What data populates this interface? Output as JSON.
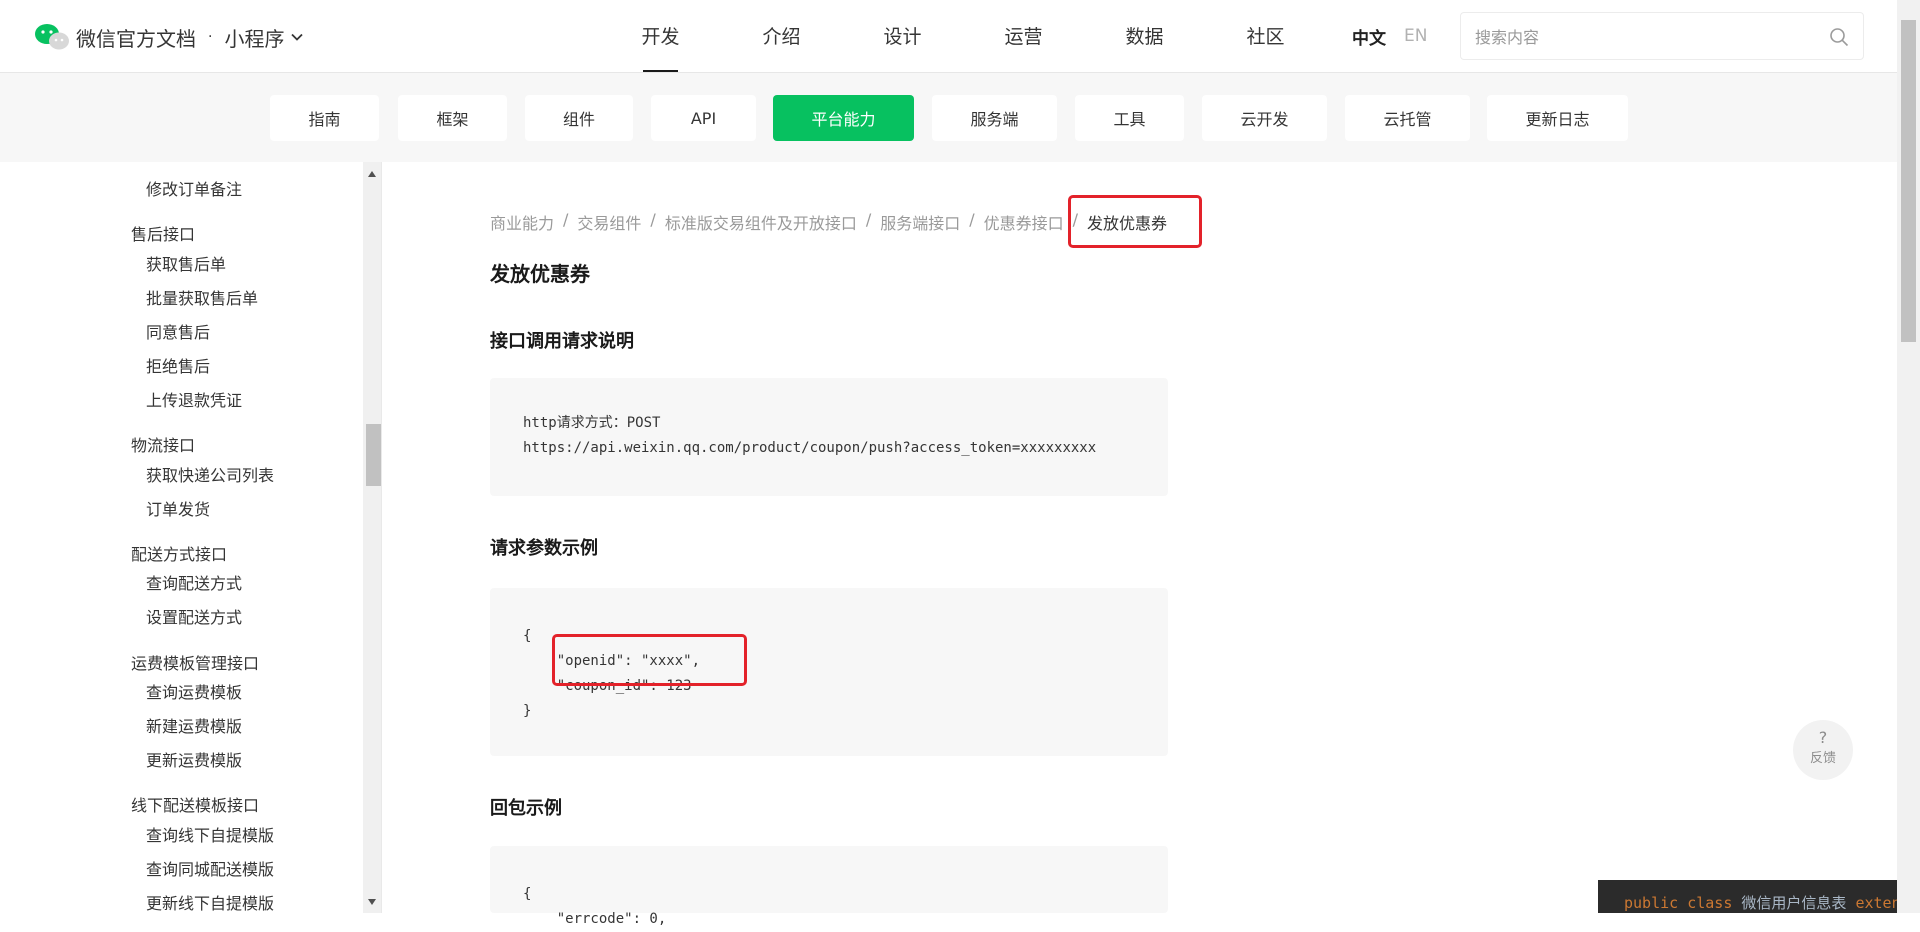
{
  "brand": {
    "title": "微信官方文档",
    "dot": "·",
    "product": "小程序"
  },
  "nav": {
    "items": [
      "开发",
      "介绍",
      "设计",
      "运营",
      "数据",
      "社区"
    ],
    "active": "开发"
  },
  "lang": {
    "zh": "中文",
    "en": "EN"
  },
  "search": {
    "placeholder": "搜索内容"
  },
  "subnav": {
    "tabs": [
      "指南",
      "框架",
      "组件",
      "API",
      "平台能力",
      "服务端",
      "工具",
      "云开发",
      "云托管",
      "更新日志"
    ],
    "active": "平台能力"
  },
  "sidebar": {
    "items": [
      {
        "type": "item",
        "label": "修改订单备注"
      },
      {
        "type": "group",
        "label": "售后接口"
      },
      {
        "type": "item",
        "label": "获取售后单"
      },
      {
        "type": "item",
        "label": "批量获取售后单"
      },
      {
        "type": "item",
        "label": "同意售后"
      },
      {
        "type": "item",
        "label": "拒绝售后"
      },
      {
        "type": "item",
        "label": "上传退款凭证"
      },
      {
        "type": "group",
        "label": "物流接口"
      },
      {
        "type": "item",
        "label": "获取快递公司列表"
      },
      {
        "type": "item",
        "label": "订单发货"
      },
      {
        "type": "group",
        "label": "配送方式接口"
      },
      {
        "type": "item",
        "label": "查询配送方式"
      },
      {
        "type": "item",
        "label": "设置配送方式"
      },
      {
        "type": "group",
        "label": "运费模板管理接口"
      },
      {
        "type": "item",
        "label": "查询运费模板"
      },
      {
        "type": "item",
        "label": "新建运费模版"
      },
      {
        "type": "item",
        "label": "更新运费模版"
      },
      {
        "type": "group",
        "label": "线下配送模板接口"
      },
      {
        "type": "item",
        "label": "查询线下自提模版"
      },
      {
        "type": "item",
        "label": "查询同城配送模版"
      },
      {
        "type": "item",
        "label": "更新线下自提模版"
      }
    ]
  },
  "breadcrumb": {
    "items": [
      "商业能力",
      "交易组件",
      "标准版交易组件及开放接口",
      "服务端接口",
      "优惠券接口"
    ],
    "separator": "/",
    "current": "发放优惠券"
  },
  "content": {
    "title": "发放优惠券",
    "section_request": "接口调用请求说明",
    "request_code": "http请求方式：POST\nhttps://api.weixin.qq.com/product/coupon/push?access_token=xxxxxxxxx",
    "section_params": "请求参数示例",
    "params_code": "{\n    \"openid\": \"xxxx\",\n    \"coupon_id\": 123\n}",
    "section_response": "回包示例",
    "response_code": "{\n    \"errcode\": 0,"
  },
  "feedback": {
    "icon": "?",
    "label": "反馈"
  },
  "ide": {
    "keywords": "public class",
    "class_name": "微信用户信息表",
    "ext": "extends"
  },
  "colors": {
    "accent": "#07c160",
    "highlight": "#e3222a"
  }
}
